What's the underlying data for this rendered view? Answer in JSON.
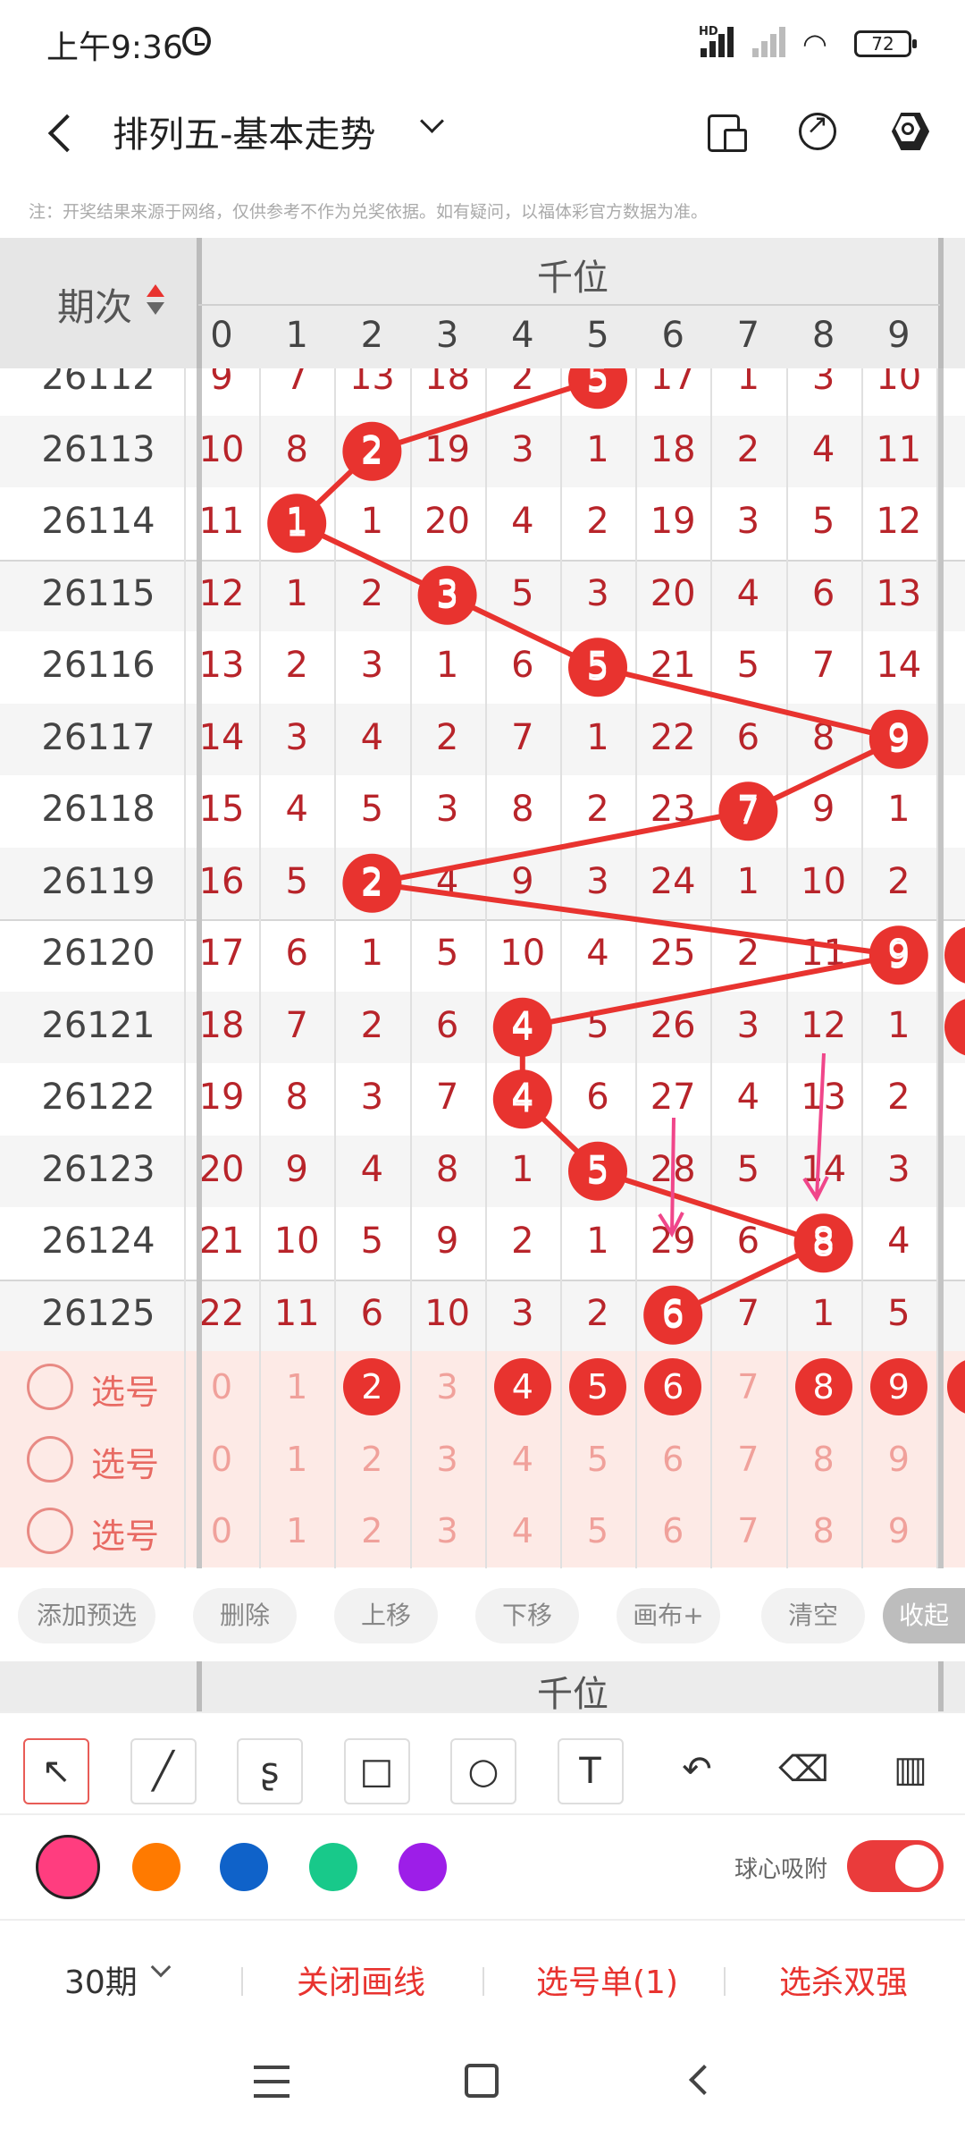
{
  "status_bar": {
    "time": "上午9:36",
    "network_label": "HD",
    "battery": "72"
  },
  "header": {
    "title": "排列五-基本走势",
    "icons": [
      "layout-icon",
      "share-icon",
      "settings-icon"
    ]
  },
  "notice": "注：开奖结果来源于网络，仅供参考不作为兑奖依据。如有疑问，以福体彩官方数据为准。",
  "table": {
    "period_header": "期次",
    "group_header": "千位",
    "digits": [
      "0",
      "1",
      "2",
      "3",
      "4",
      "5",
      "6",
      "7",
      "8",
      "9"
    ],
    "rows": [
      {
        "period": "26112",
        "cells": [
          "9",
          "7",
          "13",
          "18",
          "2",
          "5",
          "17",
          "1",
          "3",
          "10"
        ],
        "hit": 5
      },
      {
        "period": "26113",
        "cells": [
          "10",
          "8",
          "2",
          "19",
          "3",
          "1",
          "18",
          "2",
          "4",
          "11"
        ],
        "hit": 2
      },
      {
        "period": "26114",
        "cells": [
          "11",
          "1",
          "1",
          "20",
          "4",
          "2",
          "19",
          "3",
          "5",
          "12"
        ],
        "hit": 1
      },
      {
        "period": "26115",
        "cells": [
          "12",
          "1",
          "2",
          "3",
          "5",
          "3",
          "20",
          "4",
          "6",
          "13"
        ],
        "hit": 3
      },
      {
        "period": "26116",
        "cells": [
          "13",
          "2",
          "3",
          "1",
          "6",
          "5",
          "21",
          "5",
          "7",
          "14"
        ],
        "hit": 5
      },
      {
        "period": "26117",
        "cells": [
          "14",
          "3",
          "4",
          "2",
          "7",
          "1",
          "22",
          "6",
          "8",
          "9"
        ],
        "hit": 9
      },
      {
        "period": "26118",
        "cells": [
          "15",
          "4",
          "5",
          "3",
          "8",
          "2",
          "23",
          "7",
          "9",
          "1"
        ],
        "hit": 7
      },
      {
        "period": "26119",
        "cells": [
          "16",
          "5",
          "2",
          "4",
          "9",
          "3",
          "24",
          "1",
          "10",
          "2"
        ],
        "hit": 2
      },
      {
        "period": "26120",
        "cells": [
          "17",
          "6",
          "1",
          "5",
          "10",
          "4",
          "25",
          "2",
          "11",
          "9"
        ],
        "hit": 9
      },
      {
        "period": "26121",
        "cells": [
          "18",
          "7",
          "2",
          "6",
          "4",
          "5",
          "26",
          "3",
          "12",
          "1"
        ],
        "hit": 4
      },
      {
        "period": "26122",
        "cells": [
          "19",
          "8",
          "3",
          "7",
          "4",
          "6",
          "27",
          "4",
          "13",
          "2"
        ],
        "hit": 4
      },
      {
        "period": "26123",
        "cells": [
          "20",
          "9",
          "4",
          "8",
          "1",
          "5",
          "28",
          "5",
          "14",
          "3"
        ],
        "hit": 5
      },
      {
        "period": "26124",
        "cells": [
          "21",
          "10",
          "5",
          "9",
          "2",
          "1",
          "29",
          "6",
          "8",
          "4"
        ],
        "hit": 8
      },
      {
        "period": "26125",
        "cells": [
          "22",
          "11",
          "6",
          "10",
          "3",
          "2",
          "6",
          "7",
          "1",
          "5"
        ],
        "hit": 6
      }
    ],
    "pick_label": "选号",
    "pick_rows": [
      {
        "selected": [
          2,
          4,
          5,
          6,
          8,
          9
        ]
      },
      {
        "selected": []
      },
      {
        "selected": []
      }
    ]
  },
  "toolbar_buttons": [
    "添加预选",
    "删除",
    "上移",
    "下移",
    "画布+",
    "清空",
    "收起"
  ],
  "bottom_group_header": "千位",
  "draw_tools": [
    "arrow-tool-icon",
    "line-tool-icon",
    "curve-tool-icon",
    "rect-tool-icon",
    "circle-tool-icon",
    "text-tool-icon",
    "undo-icon",
    "eraser-icon",
    "clear-brush-icon"
  ],
  "colors": [
    "#ff3d7f",
    "#ff7a00",
    "#0f62c9",
    "#18c98a",
    "#9d1ee8"
  ],
  "accent": "#e8332f",
  "snap_label": "球心吸附",
  "snap_on": true,
  "bottom_actions": {
    "periods": "30期",
    "close_draw": "关闭画线",
    "pick_list": "选号单(1)",
    "filter": "选杀双强"
  }
}
